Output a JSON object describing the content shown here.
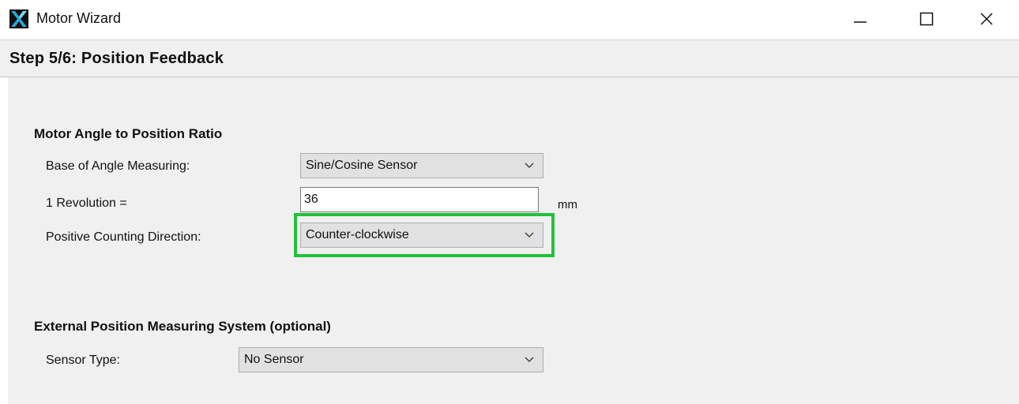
{
  "window": {
    "title": "Motor Wizard",
    "controls": {
      "minimize": "minimize",
      "maximize": "maximize",
      "close": "close"
    }
  },
  "header": {
    "step_title": "Step 5/6: Position Feedback"
  },
  "motor_angle": {
    "heading": "Motor Angle to Position Ratio",
    "base_label": "Base of Angle Measuring:",
    "base_value": "Sine/Cosine Sensor",
    "revolution_label": "1 Revolution  =",
    "revolution_value": "36",
    "revolution_unit": "mm",
    "direction_label": "Positive Counting Direction:",
    "direction_value": "Counter-clockwise"
  },
  "external": {
    "heading": "External Position Measuring System (optional)",
    "sensor_label": "Sensor Type:",
    "sensor_value": "No Sensor"
  },
  "colors": {
    "highlight": "#22c13a",
    "panel": "#f0f0f0",
    "combo": "#e1e1e1"
  }
}
